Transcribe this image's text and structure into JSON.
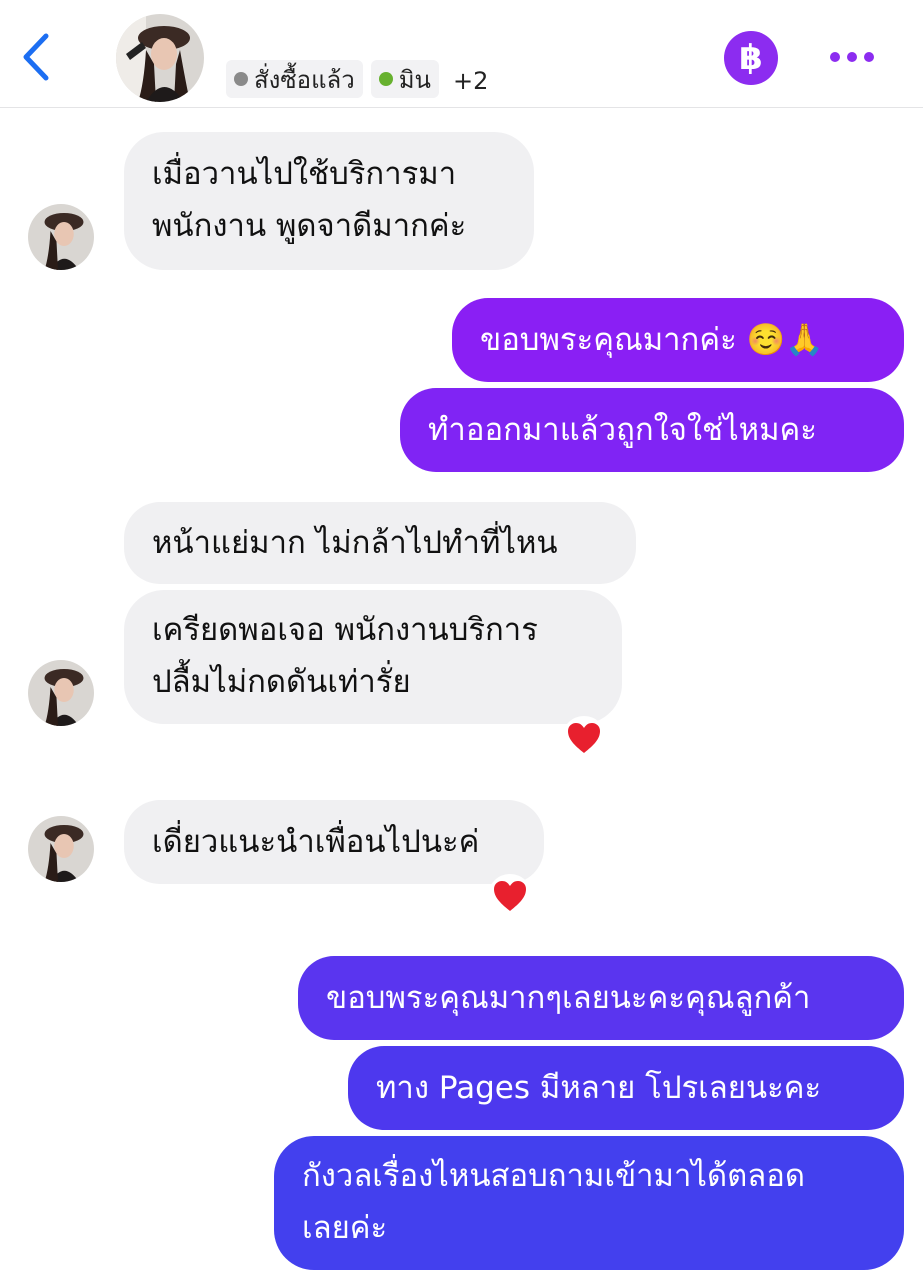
{
  "header": {
    "contact_name": "",
    "tags": [
      {
        "label": "สั่งซื้อแล้ว",
        "color": "#8a8a8a"
      },
      {
        "label": "มิน",
        "color": "#67b12f"
      }
    ],
    "more_tags": "+2",
    "baht_symbol": "฿"
  },
  "messages": [
    {
      "from": "customer",
      "lines": [
        "เมื่อวานไปใช้บริการมา",
        "พนักงาน พูดจาดีมากค่ะ"
      ]
    },
    {
      "from": "page",
      "lines": [
        "ขอบพระคุณมากค่ะ ☺️🙏"
      ],
      "color": "#8a1ff4"
    },
    {
      "from": "page",
      "lines": [
        "ทำออกมาแล้วถูกใจใช่ไหมคะ"
      ],
      "color": "#8024f4"
    },
    {
      "from": "customer",
      "lines": [
        "หน้าแย่มาก ไม่กล้าไปทำที่ไหน"
      ]
    },
    {
      "from": "customer",
      "lines": [
        "เครียดพอเจอ พนักงานบริการ",
        " ปลื้มไม่กดดันเท่ารั่ย"
      ],
      "reaction": "❤️"
    },
    {
      "from": "customer",
      "lines": [
        "เดี่ยวแนะนำเพื่อนไปนะค่"
      ],
      "reaction": "❤️"
    },
    {
      "from": "page",
      "lines": [
        "ขอบพระคุณมากๆเลยนะคะคุณลูกค้า"
      ],
      "color": "#5a35ef"
    },
    {
      "from": "page",
      "lines": [
        "ทาง Pages มีหลาย โปรเลยนะคะ"
      ],
      "color": "#4d38ee"
    },
    {
      "from": "page",
      "lines": [
        "กังวลเรื่องไหนสอบถามเข้ามาได้ตลอด",
        "เลยค่ะ"
      ],
      "color": "#4340ee"
    }
  ]
}
